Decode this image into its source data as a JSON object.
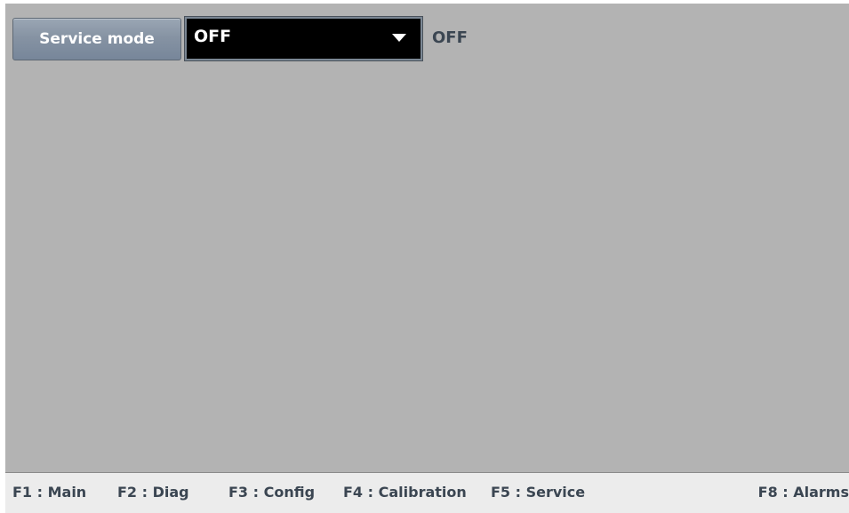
{
  "service": {
    "button_label": "Service mode",
    "selected_value": "OFF",
    "status_text": "OFF"
  },
  "footer": {
    "keys": [
      {
        "label": "F1 : Main"
      },
      {
        "label": "F2 : Diag"
      },
      {
        "label": "F3 : Config"
      },
      {
        "label": "F4 : Calibration"
      },
      {
        "label": "F5 : Service"
      },
      {
        "label": "F8 : Alarms"
      }
    ]
  },
  "colors": {
    "panel_background": "#b3b3b3",
    "button_face": "#8693a3",
    "select_background": "#000000",
    "text_dark": "#3b4652",
    "footer_background": "#ececec"
  },
  "icons": {
    "dropdown": "chevron-down-icon"
  }
}
